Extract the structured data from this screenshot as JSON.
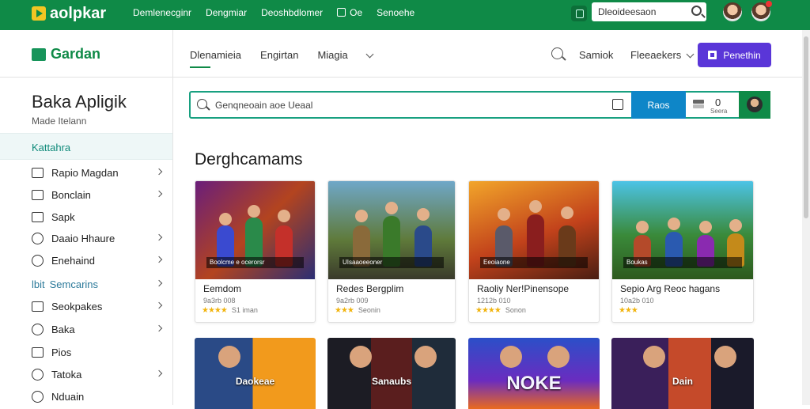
{
  "topbar": {
    "logo": "aolpkar",
    "nav": [
      "Demlenecginr",
      "Dengmiar",
      "Deoshbdlomer",
      "Oe",
      "Senoehe"
    ],
    "search_value": "Dleoideesaon",
    "color": "#0f8a47"
  },
  "header": {
    "brand": "Gardan",
    "tabs": [
      "Dlenamieia",
      "Engirtan",
      "Miagia"
    ],
    "search_label": "Samiok",
    "dropdown_label": "Fleeaekers",
    "cta_label": "Penethin",
    "cta_color": "#5a36d8"
  },
  "sidebar": {
    "title": "Baka Apligik",
    "subtitle": "Made Itelann",
    "active": "Kattahra",
    "items": [
      {
        "label": "Rapio Magdan",
        "icon": "square-icon",
        "chevron": true
      },
      {
        "label": "Bonclain",
        "icon": "clock-icon",
        "chevron": true
      },
      {
        "label": "Sapk",
        "icon": "image-icon",
        "chevron": false
      },
      {
        "label": "Daaio Hhaure",
        "icon": "circle-icon",
        "chevron": true
      },
      {
        "label": "Enehaind",
        "icon": "circle-icon",
        "chevron": true
      },
      {
        "label": "Semcarins",
        "icon": "grid-icon",
        "chevron": true,
        "prefix": "lbit"
      },
      {
        "label": "Seokpakes",
        "icon": "minus-square-icon",
        "chevron": true
      },
      {
        "label": "Baka",
        "icon": "circle-icon",
        "chevron": true
      },
      {
        "label": "Pios",
        "icon": "image-icon",
        "chevron": false
      },
      {
        "label": "Tatoka",
        "icon": "circle-icon",
        "chevron": true
      },
      {
        "label": "Nduain",
        "icon": "circle-icon",
        "chevron": false
      }
    ]
  },
  "search": {
    "placeholder": "Genqneoain aoe Ueaal",
    "button": "Raos",
    "count": "0",
    "count_sub": "Seera"
  },
  "section_title": "Derghcamams",
  "cards": [
    {
      "name": "Eemdom",
      "meta": "9a3rb 008",
      "stars": "★★★★",
      "reviews": "S1 iman",
      "banner": "Boolcme e ocerorsr"
    },
    {
      "name": "Redes Bergplim",
      "meta": "9a2rb 009",
      "stars": "★★★",
      "reviews": "Seonin",
      "banner": "UIsaaoeeoner"
    },
    {
      "name": "Raoliy Ner!Pinensope",
      "meta": "1212b 010",
      "stars": "★★★★",
      "reviews": "Sonon",
      "banner": "Eeoiaone"
    },
    {
      "name": "Sepio Arg Reoc hagans",
      "meta": "10a2b 010",
      "stars": "★★★",
      "reviews": "",
      "banner": "Boukas"
    }
  ],
  "cards_row2": [
    {
      "title": "Daokeae"
    },
    {
      "title": "Sanaubs"
    },
    {
      "title": "NOKE"
    },
    {
      "title": "Dain"
    }
  ]
}
